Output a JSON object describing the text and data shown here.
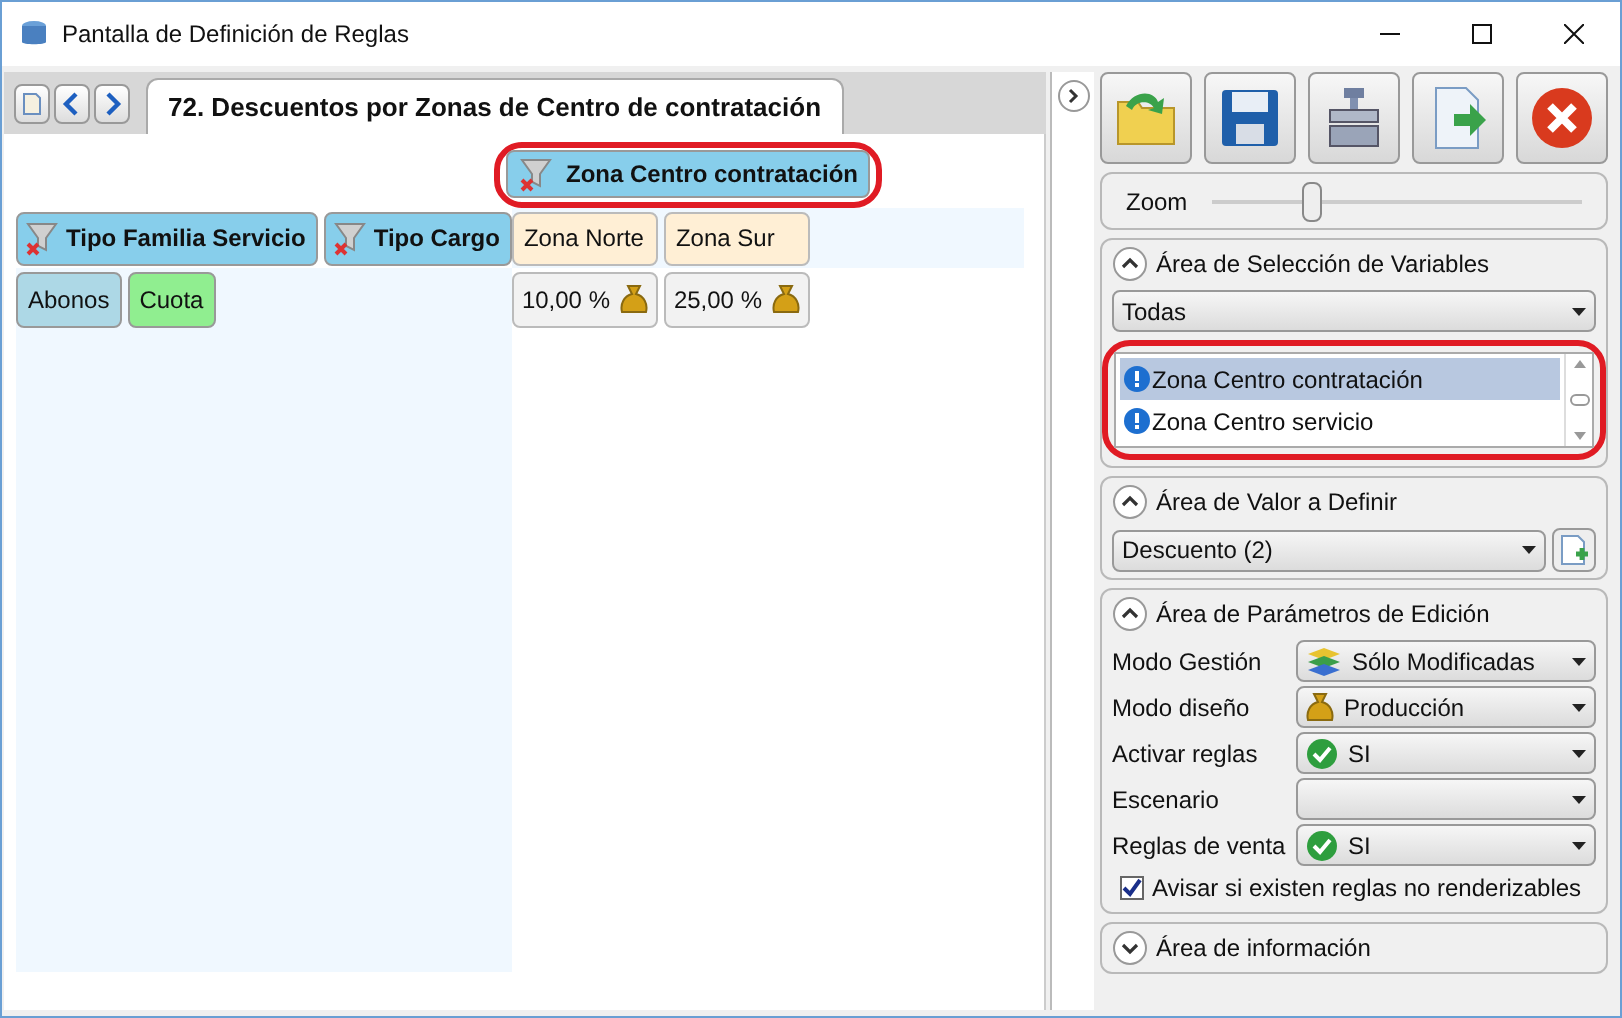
{
  "window": {
    "title": "Pantalla de Definición de Reglas"
  },
  "tab": {
    "label": "72. Descuentos por Zonas de Centro de contratación",
    "selected": true
  },
  "column_variable": {
    "label": "Zona Centro contratación",
    "highlighted": true
  },
  "row_variables": [
    {
      "label": "Tipo Familia Servicio"
    },
    {
      "label": "Tipo Cargo"
    }
  ],
  "column_values": [
    "Zona Norte",
    "Zona Sur"
  ],
  "rows": [
    {
      "values": [
        {
          "label": "Abonos",
          "kind": "family"
        },
        {
          "label": "Cuota",
          "kind": "charge"
        }
      ],
      "cells": [
        "10,00 %",
        "25,00 %"
      ]
    }
  ],
  "zoom": {
    "label": "Zoom",
    "level": 0.27
  },
  "selection_area": {
    "title": "Área de Selección de Variables",
    "expanded": true,
    "filter": "Todas",
    "highlighted": true,
    "items": [
      {
        "label": "Zona Centro contratación",
        "selected": true
      },
      {
        "label": "Zona Centro servicio",
        "selected": false
      }
    ]
  },
  "value_area": {
    "title": "Área de Valor a Definir",
    "expanded": true,
    "value": "Descuento (2)"
  },
  "params_area": {
    "title": "Área de Parámetros de Edición",
    "expanded": true,
    "fields": [
      {
        "label": "Modo Gestión",
        "value": "Sólo Modificadas",
        "kind": "layers"
      },
      {
        "label": "Modo diseño",
        "value": "Producción",
        "kind": "moneybag"
      },
      {
        "label": "Activar reglas",
        "value": "SI",
        "kind": "check"
      },
      {
        "label": "Escenario",
        "kind": "empty"
      },
      {
        "label": "Reglas de venta",
        "value": "SI",
        "kind": "check"
      }
    ],
    "checkbox": {
      "label": "Avisar si existen reglas no renderizables",
      "checked": true
    }
  },
  "info_area": {
    "title": "Área de información",
    "expanded": false
  }
}
